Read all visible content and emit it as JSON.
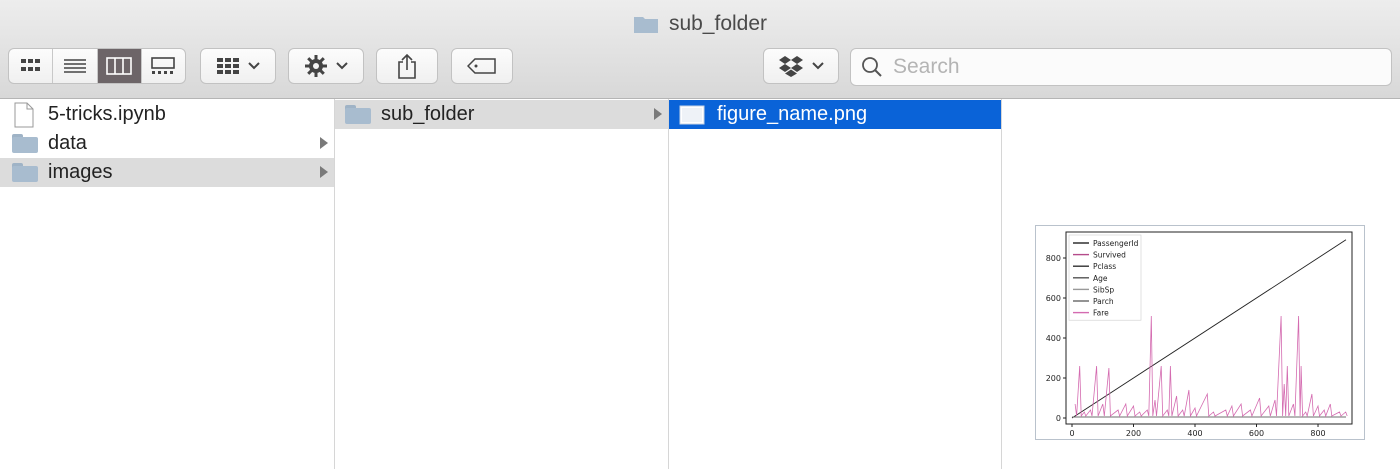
{
  "window": {
    "title": "sub_folder"
  },
  "toolbar": {
    "view_buttons": [
      "icon-view-icon",
      "list-view-icon",
      "column-view-icon",
      "gallery-view-icon"
    ],
    "active_view": "column-view-icon",
    "search_placeholder": "Search",
    "accent_active": "#6d6568"
  },
  "columns": [
    {
      "items": [
        {
          "label": "5-tricks.ipynb",
          "kind": "file"
        },
        {
          "label": "data",
          "kind": "folder"
        },
        {
          "label": "images",
          "kind": "folder",
          "selected": "gray"
        }
      ]
    },
    {
      "items": [
        {
          "label": "sub_folder",
          "kind": "folder",
          "selected": "gray"
        }
      ]
    },
    {
      "items": [
        {
          "label": "figure_name.png",
          "kind": "image",
          "selected": "blue"
        }
      ]
    }
  ],
  "colors": {
    "selection_blue": "#0a63d8",
    "selection_gray": "#dcdcdc"
  },
  "chart_data": {
    "type": "line",
    "title": "",
    "xlabel": "",
    "ylabel": "",
    "xlim": [
      0,
      891
    ],
    "ylim": [
      0,
      900
    ],
    "xticks": [
      "0",
      "200",
      "400",
      "600",
      "800"
    ],
    "yticks": [
      "0",
      "200",
      "400",
      "600",
      "800"
    ],
    "legend_position": "top-left",
    "series": [
      {
        "name": "PassengerId",
        "color": "#222222",
        "points": [
          [
            0,
            0
          ],
          [
            891,
            891
          ]
        ]
      },
      {
        "name": "Survived",
        "color": "#b54b8a",
        "points": []
      },
      {
        "name": "Pclass",
        "color": "#333333",
        "points": []
      },
      {
        "name": "Age",
        "color": "#555555",
        "points": []
      },
      {
        "name": "SibSp",
        "color": "#999999",
        "points": []
      },
      {
        "name": "Parch",
        "color": "#666666",
        "points": []
      },
      {
        "name": "Fare",
        "color": "#d46bb0",
        "points": [
          [
            10,
            70
          ],
          [
            25,
            260
          ],
          [
            40,
            30
          ],
          [
            60,
            40
          ],
          [
            80,
            260
          ],
          [
            100,
            70
          ],
          [
            120,
            250
          ],
          [
            150,
            40
          ],
          [
            175,
            70
          ],
          [
            200,
            60
          ],
          [
            220,
            30
          ],
          [
            245,
            40
          ],
          [
            258,
            510
          ],
          [
            270,
            90
          ],
          [
            290,
            260
          ],
          [
            310,
            40
          ],
          [
            320,
            260
          ],
          [
            340,
            110
          ],
          [
            360,
            40
          ],
          [
            380,
            140
          ],
          [
            400,
            50
          ],
          [
            440,
            120
          ],
          [
            460,
            30
          ],
          [
            500,
            40
          ],
          [
            520,
            60
          ],
          [
            550,
            70
          ],
          [
            580,
            40
          ],
          [
            610,
            100
          ],
          [
            640,
            60
          ],
          [
            660,
            90
          ],
          [
            680,
            510
          ],
          [
            690,
            170
          ],
          [
            700,
            260
          ],
          [
            720,
            70
          ],
          [
            737,
            510
          ],
          [
            745,
            260
          ],
          [
            760,
            30
          ],
          [
            780,
            120
          ],
          [
            800,
            60
          ],
          [
            820,
            40
          ],
          [
            840,
            70
          ],
          [
            870,
            30
          ],
          [
            890,
            30
          ]
        ]
      }
    ]
  }
}
